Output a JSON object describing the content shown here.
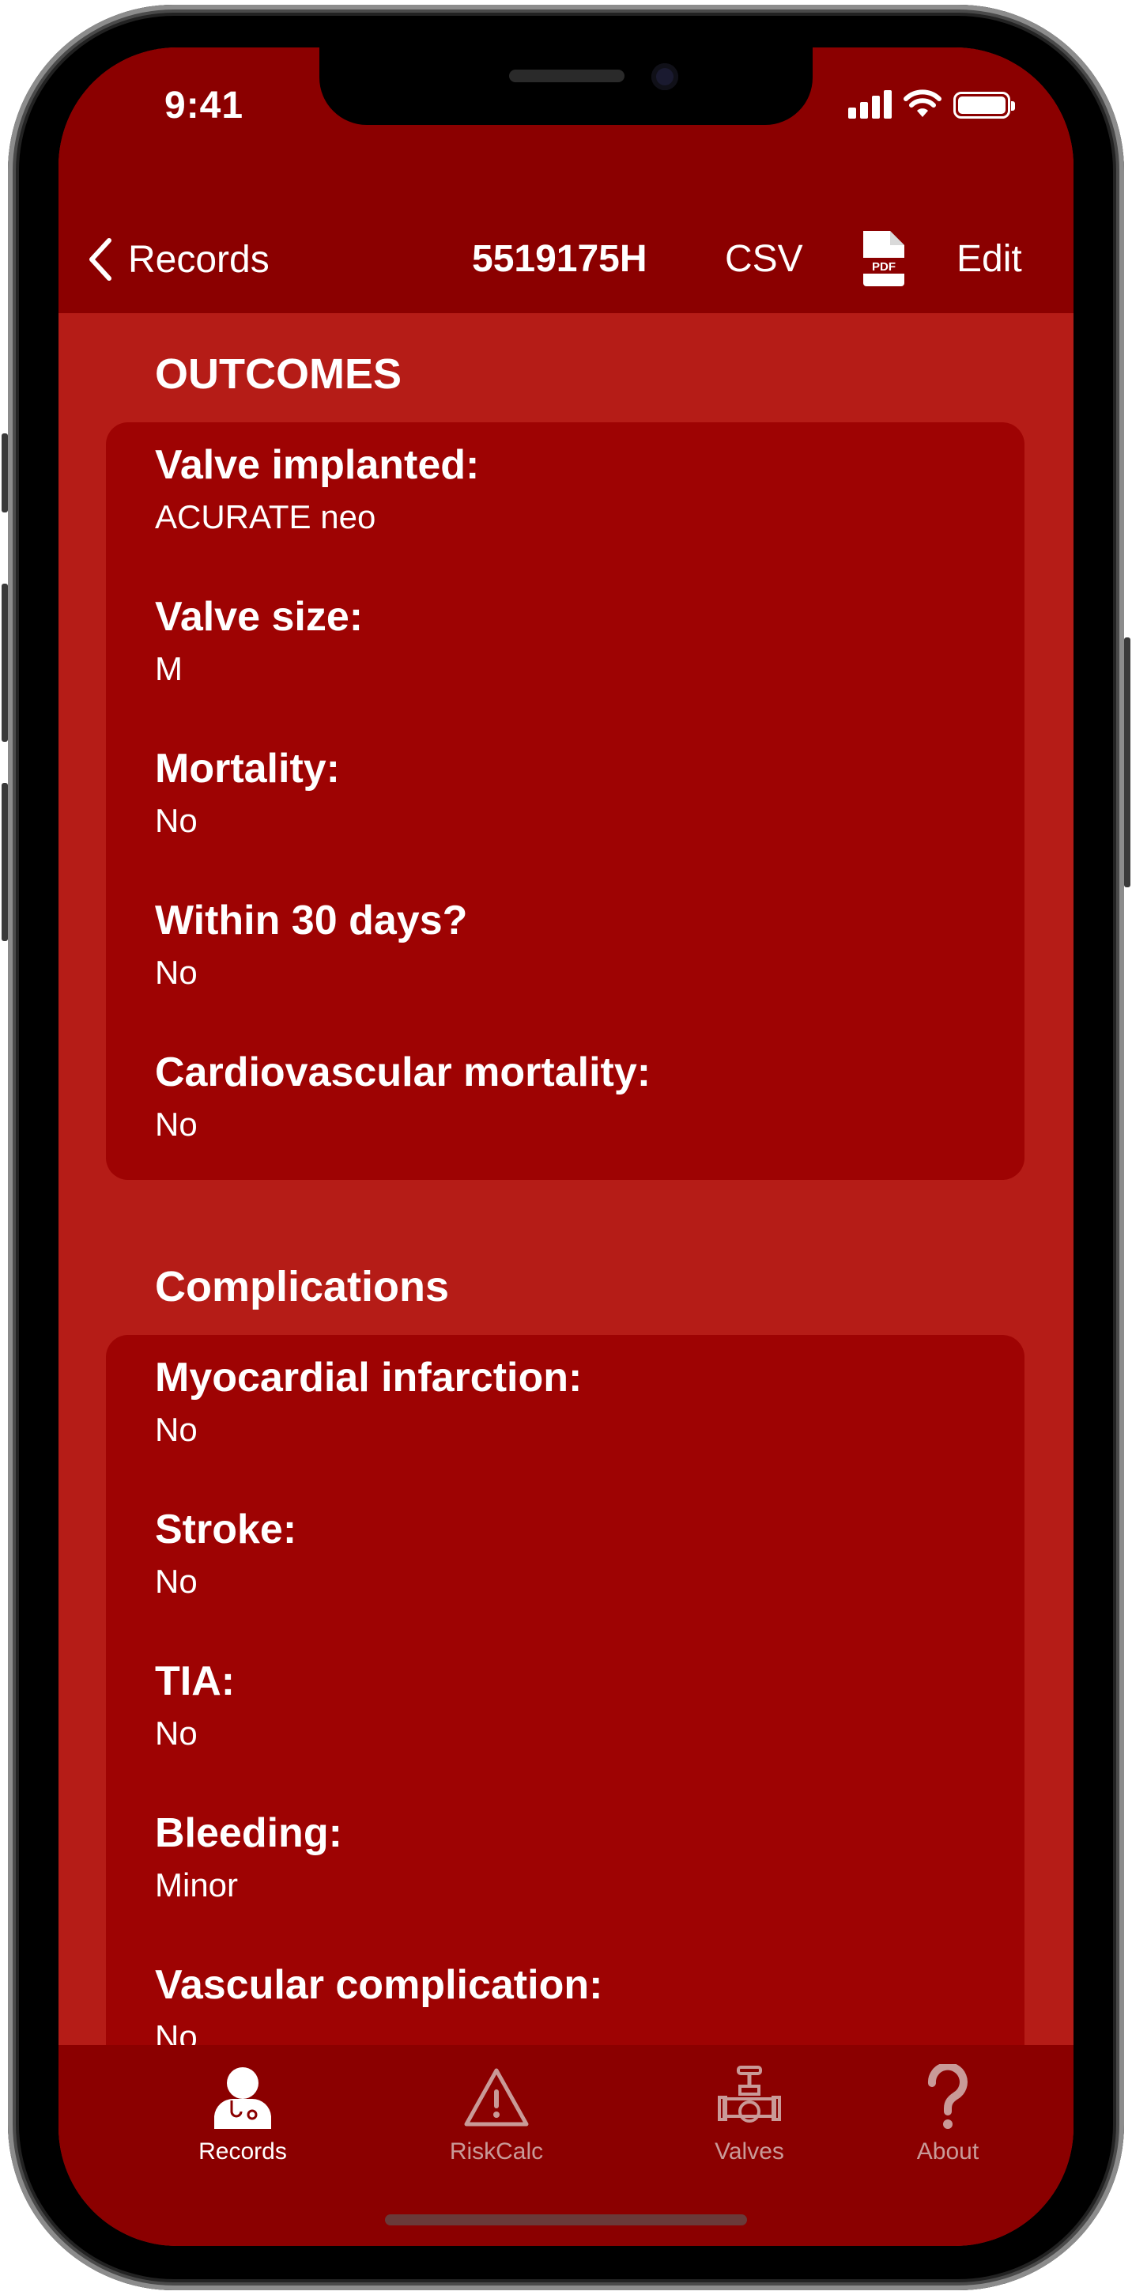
{
  "status_bar": {
    "time": "9:41"
  },
  "nav": {
    "back_label": "Records",
    "title": "5519175H",
    "csv_label": "CSV",
    "pdf_icon_text": "PDF",
    "edit_label": "Edit"
  },
  "outcomes": {
    "header": "OUTCOMES",
    "rows": [
      {
        "label": "Valve implanted:",
        "value": "ACURATE neo"
      },
      {
        "label": "Valve size:",
        "value": "M"
      },
      {
        "label": "Mortality:",
        "value": "No"
      },
      {
        "label": "Within 30 days?",
        "value": "No"
      },
      {
        "label": "Cardiovascular mortality:",
        "value": "No"
      }
    ]
  },
  "complications": {
    "header": "Complications",
    "rows": [
      {
        "label": "Myocardial infarction:",
        "value": "No"
      },
      {
        "label": "Stroke:",
        "value": "No"
      },
      {
        "label": "TIA:",
        "value": "No"
      },
      {
        "label": "Bleeding:",
        "value": "Minor"
      },
      {
        "label": "Vascular complication:",
        "value": "No"
      }
    ]
  },
  "tabs": [
    {
      "label": "Records",
      "icon": "doctor-icon",
      "active": true
    },
    {
      "label": "RiskCalc",
      "icon": "warning-triangle-icon",
      "active": false
    },
    {
      "label": "Valves",
      "icon": "valve-icon",
      "active": false
    },
    {
      "label": "About",
      "icon": "question-icon",
      "active": false
    }
  ],
  "colors": {
    "nav_background": "#8b0000",
    "content_background": "#b51c17",
    "card_background": "#9e0303",
    "inactive_tab": "#c99a98"
  }
}
